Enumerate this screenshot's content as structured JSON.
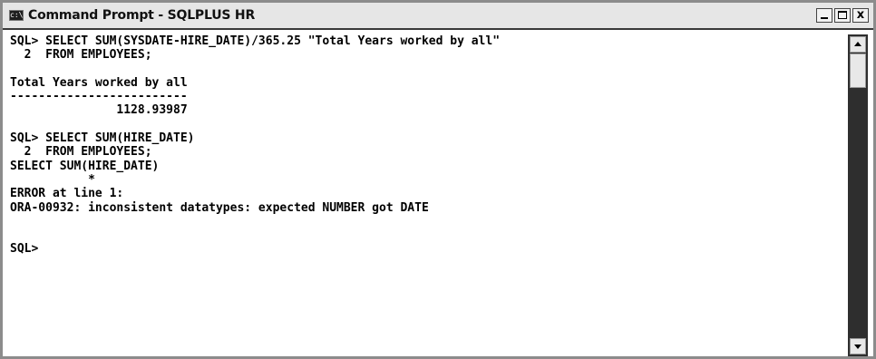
{
  "window": {
    "icon_text": "c:\\",
    "title": "Command Prompt - SQLPLUS HR",
    "controls": {
      "minimize": "minimize",
      "maximize": "maximize",
      "close": "x"
    }
  },
  "console": {
    "lines": [
      "SQL> SELECT SUM(SYSDATE-HIRE_DATE)/365.25 \"Total Years worked by all\"",
      "  2  FROM EMPLOYEES;",
      "",
      "Total Years worked by all",
      "-------------------------",
      "               1128.93987",
      "",
      "SQL> SELECT SUM(HIRE_DATE)",
      "  2  FROM EMPLOYEES;",
      "SELECT SUM(HIRE_DATE)",
      "           *",
      "ERROR at line 1:",
      "ORA-00932: inconsistent datatypes: expected NUMBER got DATE",
      "",
      "",
      "SQL>",
      "",
      "",
      "",
      "",
      ""
    ]
  },
  "scrollbar": {
    "position": 0
  }
}
